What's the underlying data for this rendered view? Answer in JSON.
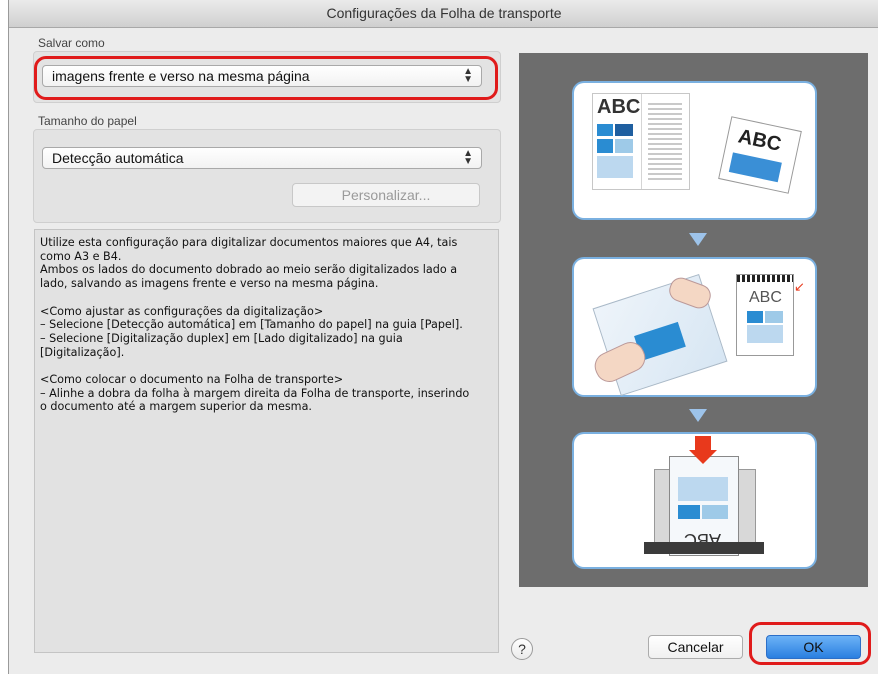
{
  "window": {
    "title": "Configurações da Folha de transporte"
  },
  "save_as": {
    "label": "Salvar como",
    "selected": "imagens frente e verso na mesma página"
  },
  "paper_size": {
    "label": "Tamanho do papel",
    "selected": "Detecção automática",
    "customize_button": "Personalizar..."
  },
  "description": {
    "lines": [
      "Utilize esta configuração para digitalizar documentos maiores que A4, tais",
      "como A3 e B4.",
      "Ambos os lados do documento dobrado ao meio serão digitalizados lado a",
      "lado, salvando as imagens frente e verso na mesma página.",
      "",
      "<Como ajustar as configurações da digitalização>",
      "– Selecione [Detecção automática] em [Tamanho do papel] na guia [Papel].",
      "– Selecione [Digitalização duplex] em [Lado digitalizado] na guia",
      "[Digitalização].",
      "",
      "<Como colocar o documento na Folha de transporte>",
      "– Alinhe a dobra da folha à margem direita da Folha de transporte, inserindo",
      "o documento até a margem superior da mesma."
    ]
  },
  "illustration": {
    "panel1_text_left": "ABC",
    "panel1_text_right": "ABC",
    "panel2_text": "ABC",
    "panel3_text": "ABC"
  },
  "buttons": {
    "help": "?",
    "cancel": "Cancelar",
    "ok": "OK"
  },
  "colors": {
    "accent_blue": "#3a8fd6",
    "highlight_red": "#e01b1b",
    "arrow_red": "#e8391c"
  }
}
